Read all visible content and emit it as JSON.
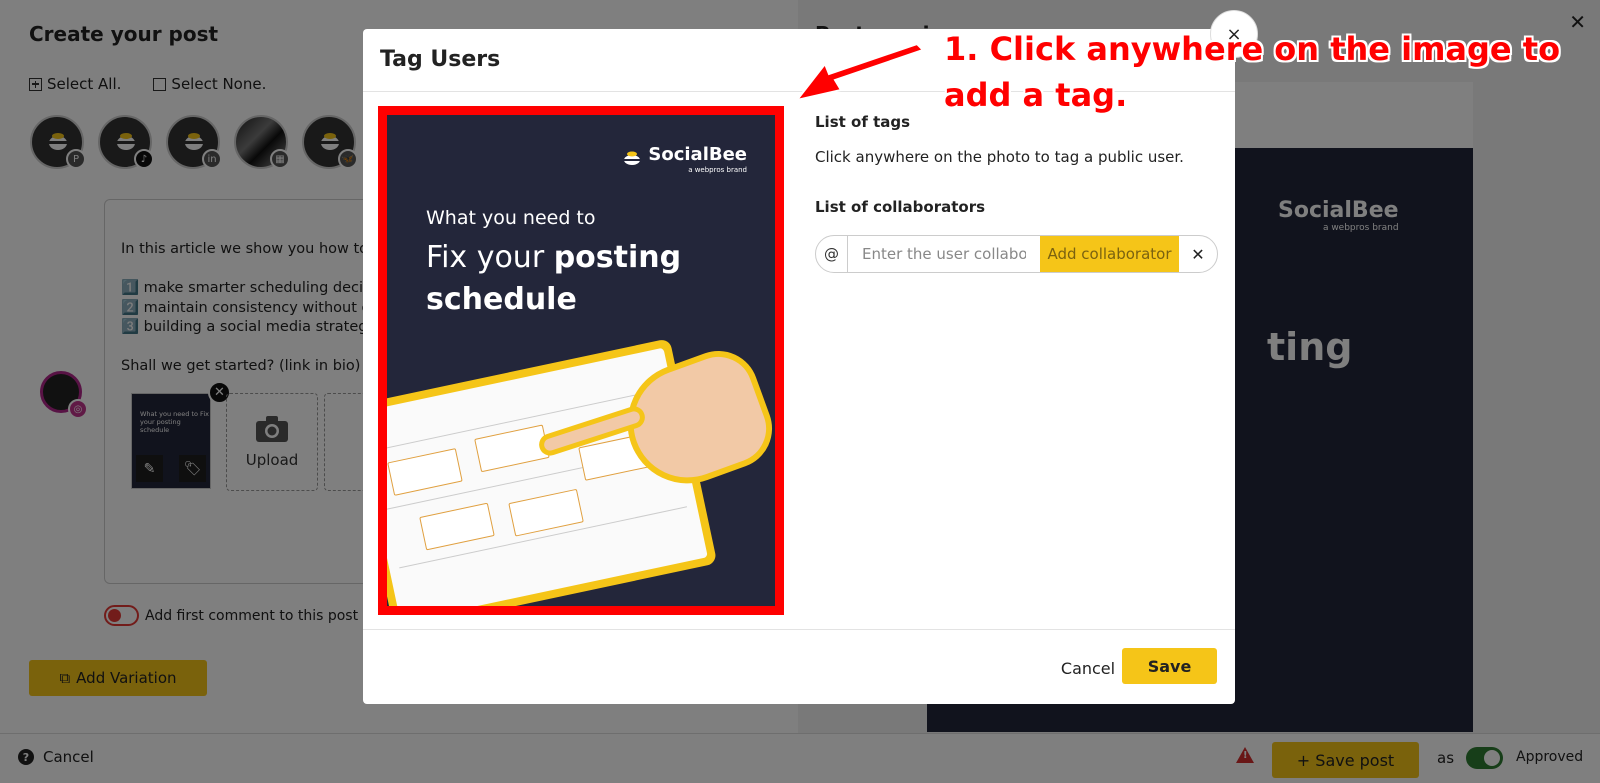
{
  "editor": {
    "title": "Create your post",
    "select_all": "Select All.",
    "select_none": "Select None.",
    "profiles": [
      {
        "network": "pinterest",
        "icon": "P"
      },
      {
        "network": "tiktok",
        "icon": "♪"
      },
      {
        "network": "linkedin",
        "icon": "in"
      },
      {
        "network": "other",
        "icon": "▦"
      },
      {
        "network": "bluesky",
        "icon": "🦋"
      }
    ],
    "post_text": "In this article we show you how to...\n\n1️⃣ make smarter scheduling decision\n2️⃣ maintain consistency without over\n3️⃣ building a social media strategy fo\n\nShall we get started? (link in bio)",
    "upload_label": "Upload",
    "first_comment_label": "Add first comment to this post",
    "add_variation_label": "Add Variation",
    "thumb_text": "What you need to Fix your posting schedule"
  },
  "preview": {
    "title": "Post preview",
    "logo": "SocialBee",
    "logo_sub": "a webpros brand",
    "big_text": "ting"
  },
  "bottom_bar": {
    "cancel_label": "Cancel",
    "save_post_label": "+ Save post",
    "as_label": "as",
    "status_label": "Approved"
  },
  "modal": {
    "title": "Tag Users",
    "close_label": "×",
    "image": {
      "logo": "SocialBee",
      "logo_sub": "a webpros brand",
      "subtitle": "What you need to",
      "heading_line1_plain": "Fix your ",
      "heading_line1_bold": "posting",
      "heading_line2_bold": "schedule"
    },
    "tags_title": "List of tags",
    "tags_hint": "Click anywhere on the photo to tag a public user.",
    "collab_title": "List of collaborators",
    "collab_prefix": "@",
    "collab_placeholder": "Enter the user collaborator",
    "collab_button": "Add collaborator",
    "collab_clear": "✕",
    "cancel_label": "Cancel",
    "save_label": "Save"
  },
  "annotation": {
    "text": "1. Click anywhere on the image to add a tag.",
    "color": "#ff0000"
  },
  "colors": {
    "accent": "#f5c518",
    "highlight": "#ff0000",
    "approved": "#2e7d32"
  }
}
